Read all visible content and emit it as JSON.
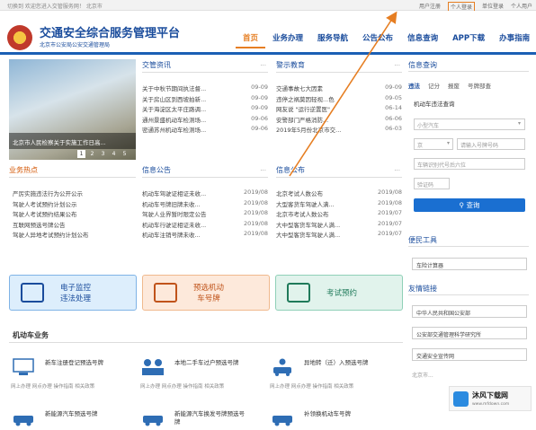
{
  "topbar": {
    "welcome": "切换到 欢迎您进入交管服务网！ 北京市",
    "links": [
      "用户注册",
      "个人登录",
      "单位登录",
      "个人用户"
    ]
  },
  "header": {
    "title": "交通安全综合服务管理平台",
    "subtitle": "北京市公安局公安交通管理局",
    "nav": [
      "首页",
      "业务办理",
      "服务导航",
      "公告公布",
      "信息查询",
      "APP下载",
      "办事指南"
    ]
  },
  "slider": {
    "caption": "北京市人民检察关于实施工作日高...",
    "pages": [
      "1",
      "2",
      "3",
      "4",
      "5"
    ]
  },
  "news": {
    "title": "交管资讯",
    "more": "...",
    "items": [
      {
        "text": "关于中秋节期间执法督...",
        "date": "09-09"
      },
      {
        "text": "关于房山区到西坡拍新...",
        "date": "09-09"
      },
      {
        "text": "关于海淀区太平庄路调...",
        "date": "09-09"
      },
      {
        "text": "通州景盛机动车检测场...",
        "date": "09-06"
      },
      {
        "text": "密通苏州机动车检测场...",
        "date": "09-06"
      }
    ]
  },
  "warning": {
    "title": "警示教育",
    "more": "...",
    "items": [
      {
        "text": "交通事故七大因素",
        "date": "09-09"
      },
      {
        "text": "违停之祸莫因轻视...色",
        "date": "09-05"
      },
      {
        "text": "网友说 \"运行逆置医\"",
        "date": "06-14"
      },
      {
        "text": "安警部门严格消防...",
        "date": "06-06"
      },
      {
        "text": "2019年5月份北京市交...",
        "date": "06-03"
      }
    ]
  },
  "hot": {
    "title": "业务热点",
    "items": [
      "严厉实施违法行为公开公示",
      "驾驶人考试预约计划公示",
      "驾驶人考试预约结果公布",
      "互联网预选号牌公告",
      "驾驶人异地考试预约计划公布"
    ]
  },
  "bulletin": {
    "title": "信息公告",
    "more": "...",
    "items": [
      {
        "text": "机动车驾驶证相证未收...",
        "date": "2019/08"
      },
      {
        "text": "机动车号牌旧牌未收...",
        "date": "2019/08"
      },
      {
        "text": "驾驶人业界暂时限定公告",
        "date": "2019/08"
      },
      {
        "text": "机动车行驶证相证未收...",
        "date": "2019/08"
      },
      {
        "text": "机动车注销号牌未收...",
        "date": "2019/08"
      }
    ]
  },
  "publish": {
    "title": "信息公布",
    "more": "...",
    "items": [
      {
        "text": "北京考试人数公布",
        "date": "2019/08"
      },
      {
        "text": "大型客货车驾驶人满...",
        "date": "2019/08"
      },
      {
        "text": "北京市考试人数公布",
        "date": "2019/07"
      },
      {
        "text": "大中型客货车驾驶人满...",
        "date": "2019/07"
      },
      {
        "text": "大中型客货车驾驶人满...",
        "date": "2019/07"
      }
    ]
  },
  "services": [
    {
      "label": "电子监控\n违法处理",
      "bg": "#ddeefc",
      "border": "#7fb3e6",
      "color": "#1a4c9c"
    },
    {
      "label": "预选机动\n车号牌",
      "bg": "#fde9db",
      "border": "#f0b98d",
      "color": "#c0531a"
    },
    {
      "label": "考试预约",
      "bg": "#e1f3ec",
      "border": "#8fd0b7",
      "color": "#1f7a5a"
    }
  ],
  "vehicle": {
    "title": "机动车业务",
    "items": [
      {
        "text": "新车注册登记预选号牌",
        "links": "网上办理  网点办理  操作指南  相关政策"
      },
      {
        "text": "本地二手车过户预选号牌",
        "links": "网上办理  网点办理  操作指南  相关政策"
      },
      {
        "text": "异地转（迁）入预选号牌",
        "links": "网上办理  网点办理  操作指南  相关政策"
      },
      {
        "text": "新能源汽车预选号牌",
        "links": ""
      },
      {
        "text": "新能源汽车换发号牌预选号牌",
        "links": ""
      },
      {
        "text": "补领换机动车号牌",
        "links": ""
      }
    ]
  },
  "query": {
    "title": "信息查询",
    "tabs": [
      "违法",
      "记分",
      "报废",
      "号牌部查"
    ],
    "section": "机动车违法查询",
    "car_type": "小型汽车",
    "plate_prefix": "京",
    "plate_placeholder": "请输入号牌号码",
    "vin_placeholder": "车辆识别代号后六位",
    "captcha_placeholder": "验证码",
    "submit": "查询"
  },
  "tools": {
    "title": "便民工具",
    "item": "车险计算器"
  },
  "friends": {
    "title": "友情链接",
    "links": [
      "中华人民共和国公安部",
      "公安部交通管理科学研究所",
      "交通安全宣传网",
      "北京市..."
    ]
  },
  "watermark": {
    "name": "沐风下载网",
    "url": "www.mfdown.com"
  }
}
